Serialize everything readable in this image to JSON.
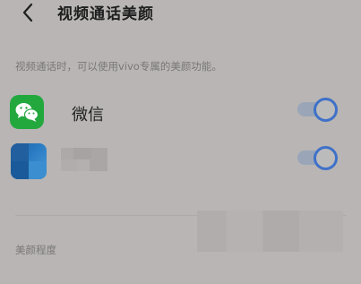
{
  "header": {
    "back_icon": "chevron-left-icon",
    "title": "视频通话美颜"
  },
  "description": "视频通话时，可以使用vivo专属的美颜功能。",
  "apps": [
    {
      "name": "微信",
      "icon": "wechat-icon",
      "enabled": true
    },
    {
      "name": "",
      "icon": "app-icon",
      "enabled": true
    }
  ],
  "section": {
    "label": "美颜程度"
  },
  "colors": {
    "background": "#b8b5b4",
    "toggle_accent": "#3f71c8",
    "wechat_green": "#23a83e"
  }
}
